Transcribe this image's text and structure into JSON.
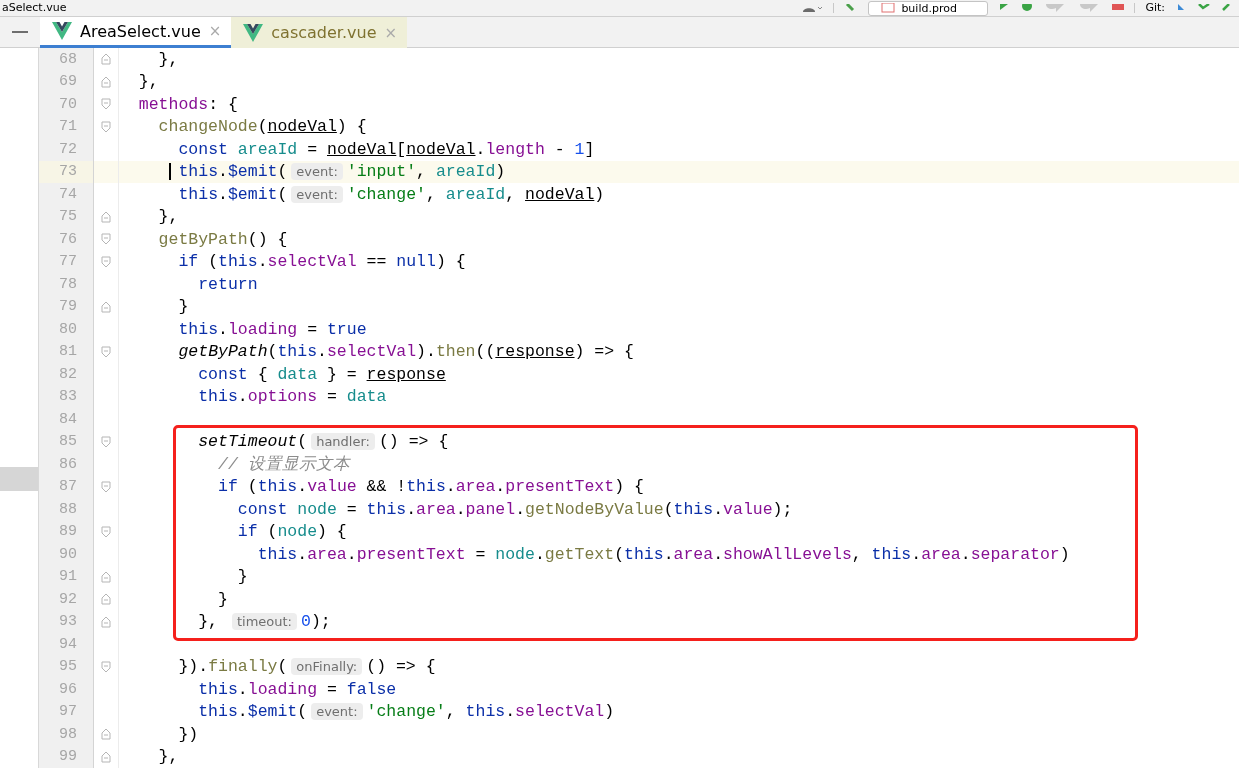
{
  "toolbar": {
    "file_title": "aSelect.vue",
    "run_config": "build.prod",
    "vcs_label": "Git:"
  },
  "tabs": [
    {
      "label": "AreaSelect.vue",
      "close": "×",
      "selected": true
    },
    {
      "label": "cascader.vue",
      "close": "×",
      "selected": false
    }
  ],
  "editor": {
    "blocks": [
      {
        "kind": "plain",
        "lines": [
          {
            "number": "68",
            "fold_end": true,
            "tokens": [
              {
                "kind": "plain",
                "text": "    },"
              }
            ]
          },
          {
            "number": "69",
            "fold_end": true,
            "tokens": [
              {
                "kind": "plain",
                "text": "  },"
              }
            ]
          },
          {
            "number": "70",
            "fold_start": true,
            "tokens": [
              {
                "kind": "prop",
                "text": "  methods"
              },
              {
                "kind": "plain",
                "text": ": {"
              }
            ]
          },
          {
            "number": "71",
            "fold_start": true,
            "tokens": [
              {
                "kind": "fn",
                "text": "    changeNode"
              },
              {
                "kind": "plain",
                "text": "("
              },
              {
                "kind": "param",
                "text": "nodeVal"
              },
              {
                "kind": "plain",
                "text": ") {"
              }
            ]
          },
          {
            "number": "72",
            "tokens": [
              {
                "kind": "kw",
                "text": "      const "
              },
              {
                "kind": "var",
                "text": "areaId"
              },
              {
                "kind": "plain",
                "text": " = "
              },
              {
                "kind": "param",
                "text": "nodeVal"
              },
              {
                "kind": "plain",
                "text": "["
              },
              {
                "kind": "param",
                "text": "nodeVal"
              },
              {
                "kind": "plain",
                "text": "."
              },
              {
                "kind": "prop",
                "text": "length"
              },
              {
                "kind": "plain",
                "text": " - "
              },
              {
                "kind": "num",
                "text": "1"
              },
              {
                "kind": "plain",
                "text": "]"
              }
            ]
          },
          {
            "number": "73",
            "current": true,
            "tokens": [
              {
                "kind": "kw",
                "text": "      this"
              },
              {
                "kind": "plain",
                "text": "."
              },
              {
                "kind": "kw",
                "text": "$emit"
              },
              {
                "kind": "plain",
                "text": "("
              },
              {
                "kind": "hint",
                "text": "event:"
              },
              {
                "kind": "str",
                "text": "'input'"
              },
              {
                "kind": "plain",
                "text": ", "
              },
              {
                "kind": "var",
                "text": "areaId"
              },
              {
                "kind": "plain",
                "text": ")"
              }
            ]
          },
          {
            "number": "74",
            "tokens": [
              {
                "kind": "kw",
                "text": "      this"
              },
              {
                "kind": "plain",
                "text": "."
              },
              {
                "kind": "kw",
                "text": "$emit"
              },
              {
                "kind": "plain",
                "text": "("
              },
              {
                "kind": "hint",
                "text": "event:"
              },
              {
                "kind": "str",
                "text": "'change'"
              },
              {
                "kind": "plain",
                "text": ", "
              },
              {
                "kind": "var",
                "text": "areaId"
              },
              {
                "kind": "plain",
                "text": ", "
              },
              {
                "kind": "param",
                "text": "nodeVal"
              },
              {
                "kind": "plain",
                "text": ")"
              }
            ]
          },
          {
            "number": "75",
            "fold_end": true,
            "tokens": [
              {
                "kind": "plain",
                "text": "    },"
              }
            ]
          },
          {
            "number": "76",
            "fold_start": true,
            "tokens": [
              {
                "kind": "fn",
                "text": "    getByPath"
              },
              {
                "kind": "plain",
                "text": "() {"
              }
            ]
          },
          {
            "number": "77",
            "fold_start": true,
            "tokens": [
              {
                "kind": "kw",
                "text": "      if"
              },
              {
                "kind": "plain",
                "text": " ("
              },
              {
                "kind": "kw",
                "text": "this"
              },
              {
                "kind": "plain",
                "text": "."
              },
              {
                "kind": "prop",
                "text": "selectVal"
              },
              {
                "kind": "plain",
                "text": " == "
              },
              {
                "kind": "kw",
                "text": "null"
              },
              {
                "kind": "plain",
                "text": ") {"
              }
            ]
          },
          {
            "number": "78",
            "tokens": [
              {
                "kind": "kw",
                "text": "        return"
              }
            ]
          },
          {
            "number": "79",
            "fold_end": true,
            "tokens": [
              {
                "kind": "plain",
                "text": "      }"
              }
            ]
          },
          {
            "number": "80",
            "tokens": [
              {
                "kind": "kw",
                "text": "      this"
              },
              {
                "kind": "plain",
                "text": "."
              },
              {
                "kind": "prop",
                "text": "loading"
              },
              {
                "kind": "plain",
                "text": " = "
              },
              {
                "kind": "kw",
                "text": "true"
              }
            ]
          },
          {
            "number": "81",
            "fold_start": true,
            "tokens": [
              {
                "kind": "call",
                "text": "      getByPath"
              },
              {
                "kind": "plain",
                "text": "("
              },
              {
                "kind": "kw",
                "text": "this"
              },
              {
                "kind": "plain",
                "text": "."
              },
              {
                "kind": "prop",
                "text": "selectVal"
              },
              {
                "kind": "plain",
                "text": ")."
              },
              {
                "kind": "fn",
                "text": "then"
              },
              {
                "kind": "plain",
                "text": "(("
              },
              {
                "kind": "param",
                "text": "response"
              },
              {
                "kind": "plain",
                "text": ") => {"
              }
            ]
          },
          {
            "number": "82",
            "tokens": [
              {
                "kind": "kw",
                "text": "        const"
              },
              {
                "kind": "plain",
                "text": " { "
              },
              {
                "kind": "var",
                "text": "data"
              },
              {
                "kind": "plain",
                "text": " } = "
              },
              {
                "kind": "param",
                "text": "response"
              }
            ]
          },
          {
            "number": "83",
            "tokens": [
              {
                "kind": "kw",
                "text": "        this"
              },
              {
                "kind": "plain",
                "text": "."
              },
              {
                "kind": "prop",
                "text": "options"
              },
              {
                "kind": "plain",
                "text": " = "
              },
              {
                "kind": "var",
                "text": "data"
              }
            ]
          },
          {
            "number": "84"
          }
        ]
      },
      {
        "kind": "highlight",
        "lines": [
          {
            "number": "85",
            "fold_start": true,
            "tokens": [
              {
                "kind": "call",
                "text": "        setTimeout"
              },
              {
                "kind": "plain",
                "text": "("
              },
              {
                "kind": "hint",
                "text": "handler:"
              },
              {
                "kind": "plain",
                "text": "() => {"
              }
            ]
          },
          {
            "number": "86",
            "tokens": [
              {
                "kind": "comment",
                "text": "          // 设置显示文本"
              }
            ]
          },
          {
            "number": "87",
            "fold_start": true,
            "tokens": [
              {
                "kind": "kw",
                "text": "          if"
              },
              {
                "kind": "plain",
                "text": " ("
              },
              {
                "kind": "kw",
                "text": "this"
              },
              {
                "kind": "plain",
                "text": "."
              },
              {
                "kind": "prop",
                "text": "value"
              },
              {
                "kind": "plain",
                "text": " && !"
              },
              {
                "kind": "kw",
                "text": "this"
              },
              {
                "kind": "plain",
                "text": "."
              },
              {
                "kind": "prop",
                "text": "area"
              },
              {
                "kind": "plain",
                "text": "."
              },
              {
                "kind": "prop",
                "text": "presentText"
              },
              {
                "kind": "plain",
                "text": ") {"
              }
            ]
          },
          {
            "number": "88",
            "tokens": [
              {
                "kind": "kw",
                "text": "            const "
              },
              {
                "kind": "var",
                "text": "node"
              },
              {
                "kind": "plain",
                "text": " = "
              },
              {
                "kind": "kw",
                "text": "this"
              },
              {
                "kind": "plain",
                "text": "."
              },
              {
                "kind": "prop",
                "text": "area"
              },
              {
                "kind": "plain",
                "text": "."
              },
              {
                "kind": "prop",
                "text": "panel"
              },
              {
                "kind": "plain",
                "text": "."
              },
              {
                "kind": "fn",
                "text": "getNodeByValue"
              },
              {
                "kind": "plain",
                "text": "("
              },
              {
                "kind": "kw",
                "text": "this"
              },
              {
                "kind": "plain",
                "text": "."
              },
              {
                "kind": "prop",
                "text": "value"
              },
              {
                "kind": "plain",
                "text": ");"
              }
            ]
          },
          {
            "number": "89",
            "fold_start": true,
            "tokens": [
              {
                "kind": "kw",
                "text": "            if"
              },
              {
                "kind": "plain",
                "text": " ("
              },
              {
                "kind": "var",
                "text": "node"
              },
              {
                "kind": "plain",
                "text": ") {"
              }
            ]
          },
          {
            "number": "90",
            "tokens": [
              {
                "kind": "kw",
                "text": "              this"
              },
              {
                "kind": "plain",
                "text": "."
              },
              {
                "kind": "prop",
                "text": "area"
              },
              {
                "kind": "plain",
                "text": "."
              },
              {
                "kind": "prop",
                "text": "presentText"
              },
              {
                "kind": "plain",
                "text": " = "
              },
              {
                "kind": "var",
                "text": "node"
              },
              {
                "kind": "plain",
                "text": "."
              },
              {
                "kind": "fn",
                "text": "getText"
              },
              {
                "kind": "plain",
                "text": "("
              },
              {
                "kind": "kw",
                "text": "this"
              },
              {
                "kind": "plain",
                "text": "."
              },
              {
                "kind": "prop",
                "text": "area"
              },
              {
                "kind": "plain",
                "text": "."
              },
              {
                "kind": "prop",
                "text": "showAllLevels"
              },
              {
                "kind": "plain",
                "text": ", "
              },
              {
                "kind": "kw",
                "text": "this"
              },
              {
                "kind": "plain",
                "text": "."
              },
              {
                "kind": "prop",
                "text": "area"
              },
              {
                "kind": "plain",
                "text": "."
              },
              {
                "kind": "prop",
                "text": "separator"
              },
              {
                "kind": "plain",
                "text": ")"
              }
            ]
          },
          {
            "number": "91",
            "fold_end": true,
            "tokens": [
              {
                "kind": "plain",
                "text": "            }"
              }
            ]
          },
          {
            "number": "92",
            "fold_end": true,
            "tokens": [
              {
                "kind": "plain",
                "text": "          }"
              }
            ]
          },
          {
            "number": "93",
            "fold_end": true,
            "tokens": [
              {
                "kind": "plain",
                "text": "        }, "
              },
              {
                "kind": "hint",
                "text": "timeout:"
              },
              {
                "kind": "num",
                "text": "0"
              },
              {
                "kind": "plain",
                "text": ");"
              }
            ]
          }
        ]
      },
      {
        "kind": "plain",
        "lines": [
          {
            "number": "94"
          },
          {
            "number": "95",
            "fold_start": true,
            "tokens": [
              {
                "kind": "plain",
                "text": "      })."
              },
              {
                "kind": "fn",
                "text": "finally"
              },
              {
                "kind": "plain",
                "text": "("
              },
              {
                "kind": "hint",
                "text": "onFinally:"
              },
              {
                "kind": "plain",
                "text": "() => {"
              }
            ]
          },
          {
            "number": "96",
            "tokens": [
              {
                "kind": "kw",
                "text": "        this"
              },
              {
                "kind": "plain",
                "text": "."
              },
              {
                "kind": "prop",
                "text": "loading"
              },
              {
                "kind": "plain",
                "text": " = "
              },
              {
                "kind": "kw",
                "text": "false"
              }
            ]
          },
          {
            "number": "97",
            "tokens": [
              {
                "kind": "kw",
                "text": "        this"
              },
              {
                "kind": "plain",
                "text": "."
              },
              {
                "kind": "kw",
                "text": "$emit"
              },
              {
                "kind": "plain",
                "text": "("
              },
              {
                "kind": "hint",
                "text": "event:"
              },
              {
                "kind": "str",
                "text": "'change'"
              },
              {
                "kind": "plain",
                "text": ", "
              },
              {
                "kind": "kw",
                "text": "this"
              },
              {
                "kind": "plain",
                "text": "."
              },
              {
                "kind": "prop",
                "text": "selectVal"
              },
              {
                "kind": "plain",
                "text": ")"
              }
            ]
          },
          {
            "number": "98",
            "fold_end": true,
            "tokens": [
              {
                "kind": "plain",
                "text": "      })"
              }
            ]
          },
          {
            "number": "99",
            "fold_end": true,
            "tokens": [
              {
                "kind": "plain",
                "text": "    },"
              }
            ]
          }
        ]
      }
    ]
  }
}
